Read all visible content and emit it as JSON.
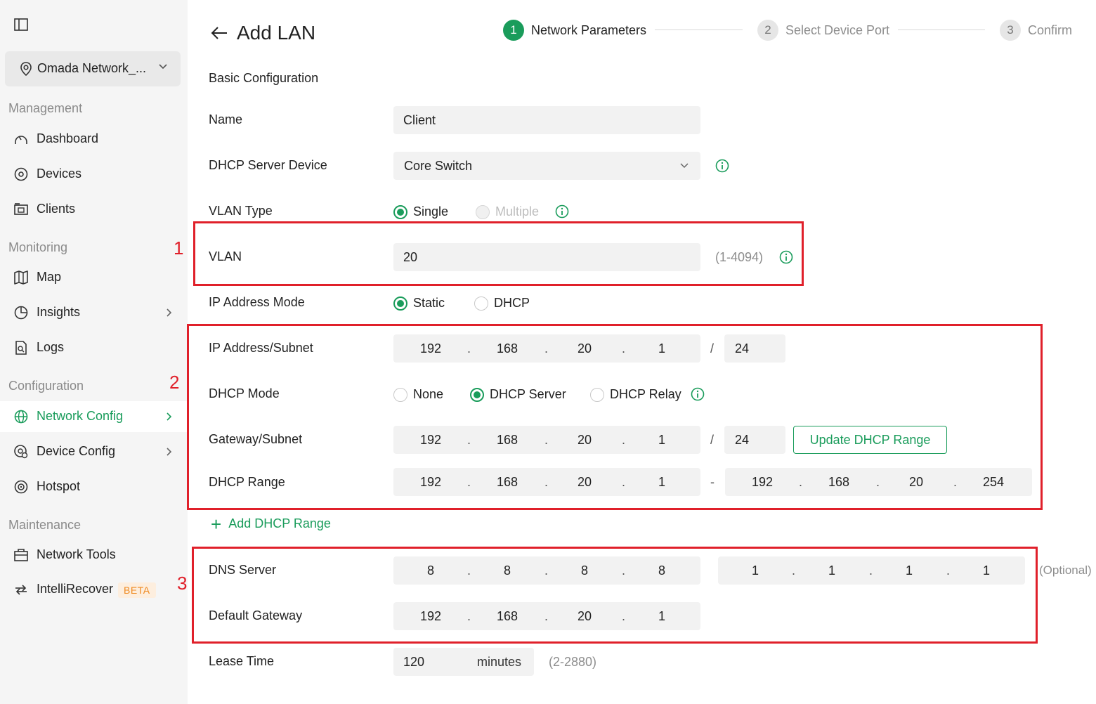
{
  "sidebar": {
    "site_name": "Omada Network_...",
    "sections": {
      "management": "Management",
      "monitoring": "Monitoring",
      "configuration": "Configuration",
      "maintenance": "Maintenance"
    },
    "items": {
      "dashboard": "Dashboard",
      "devices": "Devices",
      "clients": "Clients",
      "map": "Map",
      "insights": "Insights",
      "logs": "Logs",
      "network_config": "Network Config",
      "device_config": "Device Config",
      "hotspot": "Hotspot",
      "network_tools": "Network Tools",
      "intellirecover": "IntelliRecover",
      "beta_badge": "BETA"
    },
    "active_item": "Network Config",
    "accent_color": "#1a9c5b"
  },
  "header": {
    "title": "Add LAN",
    "steps": [
      {
        "num": "1",
        "label": "Network Parameters",
        "state": "active"
      },
      {
        "num": "2",
        "label": "Select Device Port",
        "state": "inactive"
      },
      {
        "num": "3",
        "label": "Confirm",
        "state": "inactive"
      }
    ]
  },
  "form": {
    "section_title": "Basic Configuration",
    "name": {
      "label": "Name",
      "value": "Client"
    },
    "dhcp_server_device": {
      "label": "DHCP Server Device",
      "value": "Core Switch"
    },
    "vlan_type": {
      "label": "VLAN Type",
      "options": {
        "single": "Single",
        "multiple": "Multiple"
      },
      "selected": "Single"
    },
    "vlan": {
      "label": "VLAN",
      "value": "20",
      "hint": "(1-4094)"
    },
    "ip_address_mode": {
      "label": "IP Address Mode",
      "options": {
        "static": "Static",
        "dhcp": "DHCP"
      },
      "selected": "Static"
    },
    "ip_subnet": {
      "label": "IP Address/Subnet",
      "octets": [
        "192",
        "168",
        "20",
        "1"
      ],
      "slash": "/",
      "mask": "24"
    },
    "dhcp_mode": {
      "label": "DHCP Mode",
      "options": {
        "none": "None",
        "server": "DHCP Server",
        "relay": "DHCP Relay"
      },
      "selected": "DHCP Server"
    },
    "gateway_subnet": {
      "label": "Gateway/Subnet",
      "octets": [
        "192",
        "168",
        "20",
        "1"
      ],
      "slash": "/",
      "mask": "24",
      "update_button": "Update DHCP Range"
    },
    "dhcp_range": {
      "label": "DHCP Range",
      "start": [
        "192",
        "168",
        "20",
        "1"
      ],
      "dash": "-",
      "end": [
        "192",
        "168",
        "20",
        "254"
      ]
    },
    "add_dhcp_range": "Add DHCP Range",
    "dns_server": {
      "label": "DNS Server",
      "primary": [
        "8",
        "8",
        "8",
        "8"
      ],
      "secondary": [
        "1",
        "1",
        "1",
        "1"
      ],
      "hint": "(Optional)"
    },
    "default_gateway": {
      "label": "Default Gateway",
      "octets": [
        "192",
        "168",
        "20",
        "1"
      ]
    },
    "lease_time": {
      "label": "Lease Time",
      "value": "120",
      "unit": "minutes",
      "hint": "(2-2880)"
    },
    "dot": "."
  },
  "annotations": [
    "1",
    "2",
    "3"
  ],
  "annotation_color": "#e0202a"
}
